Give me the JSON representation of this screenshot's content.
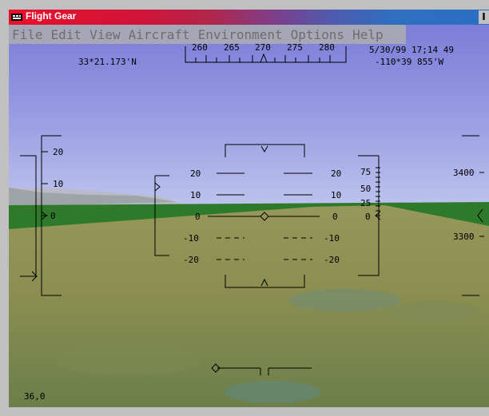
{
  "window": {
    "title": "Flight Gear",
    "close_glyph": "I"
  },
  "menu": {
    "items": [
      "File",
      "Edit",
      "View",
      "Aircraft",
      "Environment",
      "Options",
      "Help"
    ]
  },
  "hud": {
    "latitude": "33*21.173'N",
    "longitude": "-110*39 855'W",
    "datetime": "5/30/99 17;14 49",
    "heading_ticks": [
      "260",
      "265",
      "270",
      "275",
      "280"
    ],
    "left_tape": [
      "20",
      "10",
      "0"
    ],
    "pitch_left": [
      "20",
      "10",
      "0",
      "-10",
      "-20"
    ],
    "pitch_right": [
      "20",
      "10",
      "0",
      "-10",
      "-20"
    ],
    "throttle_ticks": [
      "75",
      "50",
      "25",
      "0"
    ],
    "altitude_ticks": [
      "3400",
      "3300"
    ],
    "bottom_value": "36,0"
  },
  "colors": {
    "hud": "#000000",
    "sky_top": "#7c7ed8",
    "field": "#8a9050",
    "grass": "#2e7a2a"
  }
}
